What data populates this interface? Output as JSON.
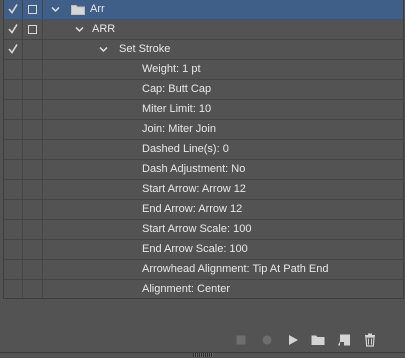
{
  "actions": {
    "rows": [
      {
        "label": "Arr",
        "checked": true,
        "has_box": true,
        "expanded": true,
        "folder": true,
        "level": 0,
        "selected": true
      },
      {
        "label": "ARR",
        "checked": true,
        "has_box": true,
        "expanded": true,
        "folder": false,
        "level": 1,
        "selected": false
      },
      {
        "label": "Set Stroke",
        "checked": true,
        "has_box": false,
        "expanded": true,
        "folder": false,
        "level": 2,
        "selected": false
      },
      {
        "label": "Weight: 1 pt",
        "checked": false,
        "has_box": false,
        "level": 3
      },
      {
        "label": "Cap: Butt Cap",
        "checked": false,
        "has_box": false,
        "level": 3
      },
      {
        "label": "Miter Limit: 10",
        "checked": false,
        "has_box": false,
        "level": 3
      },
      {
        "label": "Join: Miter Join",
        "checked": false,
        "has_box": false,
        "level": 3
      },
      {
        "label": "Dashed Line(s): 0",
        "checked": false,
        "has_box": false,
        "level": 3
      },
      {
        "label": "Dash Adjustment: No",
        "checked": false,
        "has_box": false,
        "level": 3
      },
      {
        "label": "Start Arrow: Arrow 12",
        "checked": false,
        "has_box": false,
        "level": 3
      },
      {
        "label": "End Arrow: Arrow 12",
        "checked": false,
        "has_box": false,
        "level": 3
      },
      {
        "label": "Start Arrow Scale: 100",
        "checked": false,
        "has_box": false,
        "level": 3
      },
      {
        "label": "End Arrow Scale: 100",
        "checked": false,
        "has_box": false,
        "level": 3
      },
      {
        "label": "Arrowhead Alignment: Tip At Path End",
        "checked": false,
        "has_box": false,
        "level": 3
      },
      {
        "label": "Alignment: Center",
        "checked": false,
        "has_box": false,
        "level": 3
      }
    ]
  },
  "toolbar": {
    "buttons": [
      {
        "name": "stop-icon",
        "enabled": false
      },
      {
        "name": "record-icon",
        "enabled": false
      },
      {
        "name": "play-icon",
        "enabled": true
      },
      {
        "name": "folder-icon",
        "enabled": true
      },
      {
        "name": "new-action-icon",
        "enabled": true
      },
      {
        "name": "trash-icon",
        "enabled": true
      }
    ]
  },
  "colors": {
    "panel_bg": "#535353",
    "selected_row": "#3f5f88",
    "text": "#e8e8e8",
    "disabled_icon": "#6e6e6e"
  }
}
